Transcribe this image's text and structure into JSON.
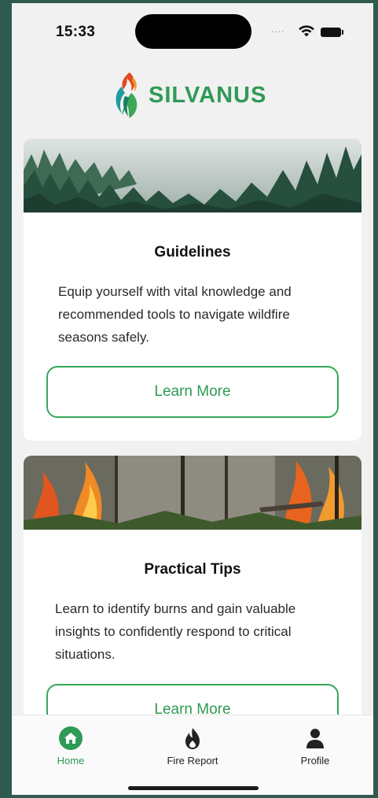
{
  "status_bar": {
    "time": "15:33",
    "signal": "....",
    "icons": [
      "wifi-icon",
      "battery-icon"
    ]
  },
  "brand": {
    "name": "SILVANUS",
    "color": "#2f9a57",
    "accent": "#e04a1f"
  },
  "cards": [
    {
      "title": "Guidelines",
      "description": "Equip yourself with vital knowledge and recommended tools to navigate wildfire seasons safely.",
      "button": "Learn More",
      "image": "misty-forest"
    },
    {
      "title": "Practical Tips",
      "description": "Learn to identify burns and gain valuable insights to confidently respond to critical situations.",
      "button": "Learn More",
      "image": "forest-fire"
    }
  ],
  "tab_bar": {
    "items": [
      {
        "label": "Home",
        "icon": "home-icon",
        "active": true
      },
      {
        "label": "Fire Report",
        "icon": "fire-icon",
        "active": false
      },
      {
        "label": "Profile",
        "icon": "person-icon",
        "active": false
      }
    ],
    "active_color": "#2f9a57"
  }
}
